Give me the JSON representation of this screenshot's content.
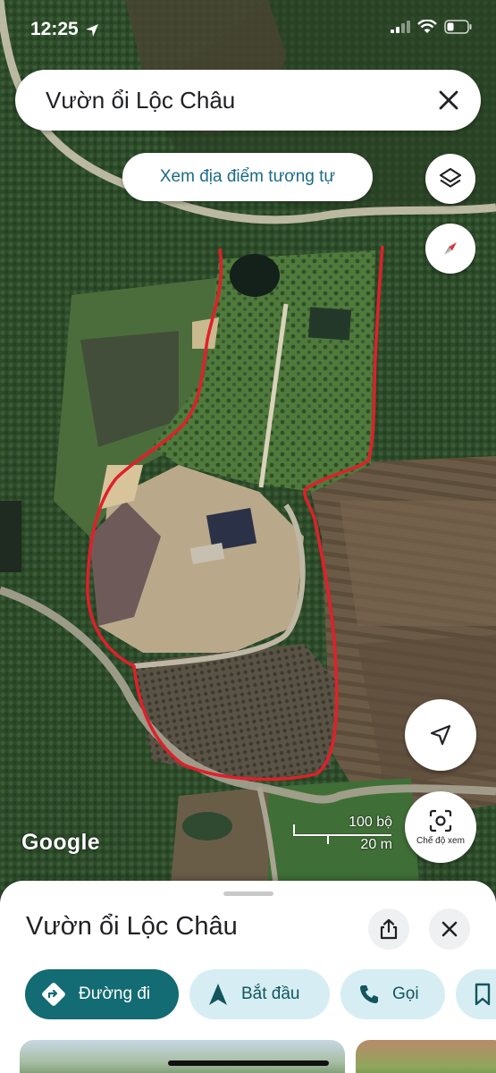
{
  "status_bar": {
    "time": "12:25",
    "icons": [
      "location-arrow-icon",
      "signal-icon",
      "wifi-icon",
      "battery-icon"
    ]
  },
  "search": {
    "query": "Vườn ổi Lộc Châu"
  },
  "map": {
    "similar_places_button": "Xem địa điểm tương tự",
    "attribution": "Google",
    "scale": {
      "imperial": "100 bộ",
      "metric": "20 m"
    },
    "view_mode_label": "Chế độ xem",
    "boundary_color": "#e0202a"
  },
  "place_sheet": {
    "title": "Vườn ổi Lộc Châu",
    "actions": {
      "directions": "Đường đi",
      "start": "Bắt đầu",
      "call": "Gọi"
    }
  },
  "colors": {
    "primary_action": "#136b73",
    "secondary_action": "#d6eef3",
    "link_text": "#1a6b8a"
  }
}
